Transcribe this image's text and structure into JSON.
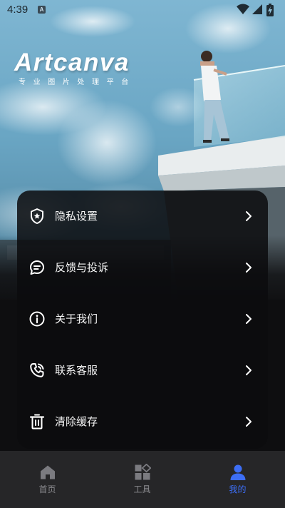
{
  "status_bar": {
    "time": "4:39",
    "notification_icon_letter": "A"
  },
  "brand": {
    "name": "Artcanva",
    "tagline": "专业图片处理平台"
  },
  "menu": {
    "items": [
      {
        "label": "隐私设置",
        "icon": "shield-star-icon"
      },
      {
        "label": "反馈与投诉",
        "icon": "chat-bubble-icon"
      },
      {
        "label": "关于我们",
        "icon": "info-circle-icon"
      },
      {
        "label": "联系客服",
        "icon": "phone-icon"
      },
      {
        "label": "清除缓存",
        "icon": "trash-icon"
      }
    ]
  },
  "bottom_nav": {
    "items": [
      {
        "label": "首页",
        "icon": "home-icon",
        "active": false
      },
      {
        "label": "工具",
        "icon": "grid-icon",
        "active": false
      },
      {
        "label": "我的",
        "icon": "user-icon",
        "active": true
      }
    ]
  },
  "colors": {
    "accent": "#3d6ef5",
    "card_background": "#0c0c0e",
    "nav_background": "#262628",
    "text_primary": "#f4f4f4",
    "text_muted": "#8a8a8e"
  }
}
